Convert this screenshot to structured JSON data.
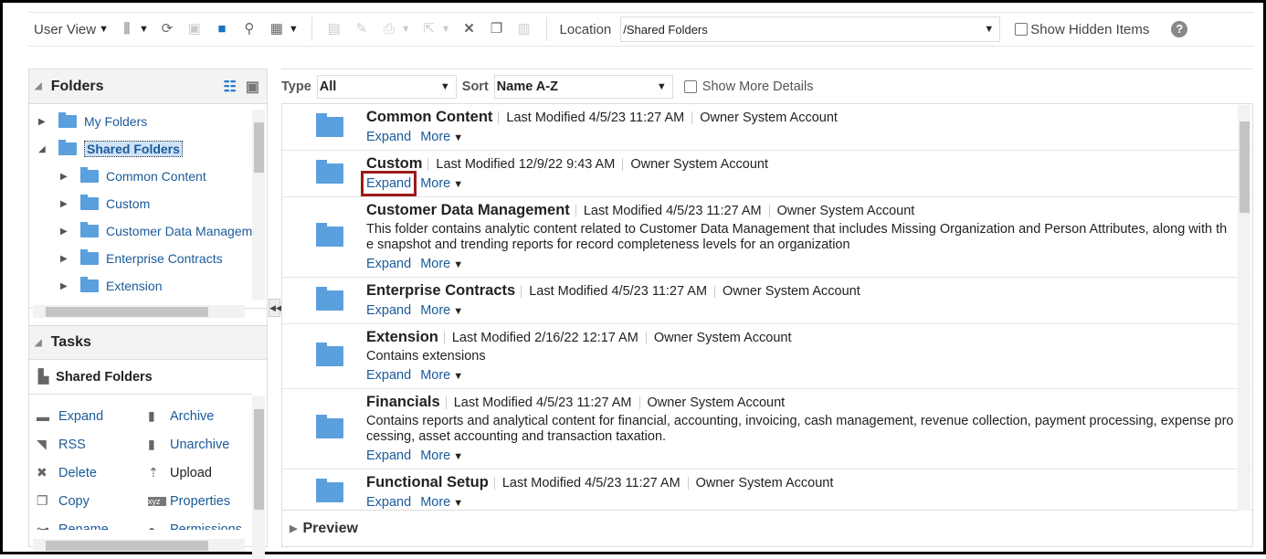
{
  "toolbar": {
    "user_view": "User View",
    "location_label": "Location",
    "location_value": "/Shared Folders",
    "show_hidden": "Show Hidden Items",
    "help": "?"
  },
  "folders_panel": {
    "title": "Folders",
    "items": [
      {
        "label": "My Folders",
        "level": 0,
        "expanded": false
      },
      {
        "label": "Shared Folders",
        "level": 0,
        "expanded": true,
        "selected": true
      },
      {
        "label": "Common Content",
        "level": 1
      },
      {
        "label": "Custom",
        "level": 1
      },
      {
        "label": "Customer Data Managem",
        "level": 1
      },
      {
        "label": "Enterprise Contracts",
        "level": 1
      },
      {
        "label": "Extension",
        "level": 1
      }
    ]
  },
  "tasks_panel": {
    "title": "Tasks",
    "context": "Shared Folders",
    "items": [
      {
        "label": "Expand",
        "icon": "folder-icon"
      },
      {
        "label": "Archive",
        "icon": "archive-icon"
      },
      {
        "label": "RSS",
        "icon": "rss-icon"
      },
      {
        "label": "Unarchive",
        "icon": "unarchive-icon"
      },
      {
        "label": "Delete",
        "icon": "delete-icon"
      },
      {
        "label": "Upload",
        "icon": "upload-icon"
      },
      {
        "label": "Copy",
        "icon": "copy-icon"
      },
      {
        "label": "Properties",
        "icon": "properties-icon"
      },
      {
        "label": "Rename",
        "icon": "rename-icon"
      },
      {
        "label": "Permissions",
        "icon": "permissions-icon"
      }
    ]
  },
  "filters": {
    "type_label": "Type",
    "type_value": "All",
    "sort_label": "Sort",
    "sort_value": "Name A-Z",
    "show_more": "Show More Details"
  },
  "list": {
    "expand_label": "Expand",
    "more_label": "More",
    "items": [
      {
        "name": "Common Content",
        "modified": "Last Modified 4/5/23 11:27 AM",
        "owner": "Owner System Account",
        "desc": ""
      },
      {
        "name": "Custom",
        "modified": "Last Modified 12/9/22 9:43 AM",
        "owner": "Owner System Account",
        "desc": "",
        "highlight": true
      },
      {
        "name": "Customer Data Management",
        "modified": "Last Modified 4/5/23 11:27 AM",
        "owner": "Owner System Account",
        "desc": "This folder contains analytic content related to Customer Data Management that includes Missing Organization and Person Attributes, along with the snapshot and trending reports for record completeness levels for an organization"
      },
      {
        "name": "Enterprise Contracts",
        "modified": "Last Modified 4/5/23 11:27 AM",
        "owner": "Owner System Account",
        "desc": ""
      },
      {
        "name": "Extension",
        "modified": "Last Modified 2/16/22 12:17 AM",
        "owner": "Owner System Account",
        "desc": "Contains extensions"
      },
      {
        "name": "Financials",
        "modified": "Last Modified 4/5/23 11:27 AM",
        "owner": "Owner System Account",
        "desc": "Contains reports and analytical content for financial, accounting, invoicing, cash management, revenue collection, payment processing, expense processing, asset accounting and transaction taxation."
      },
      {
        "name": "Functional Setup",
        "modified": "Last Modified 4/5/23 11:27 AM",
        "owner": "Owner System Account",
        "desc": ""
      }
    ]
  },
  "preview": {
    "title": "Preview"
  },
  "colors": {
    "link": "#1a5a9a",
    "folder": "#5aa0dc",
    "highlight": "#9b1c1c"
  }
}
